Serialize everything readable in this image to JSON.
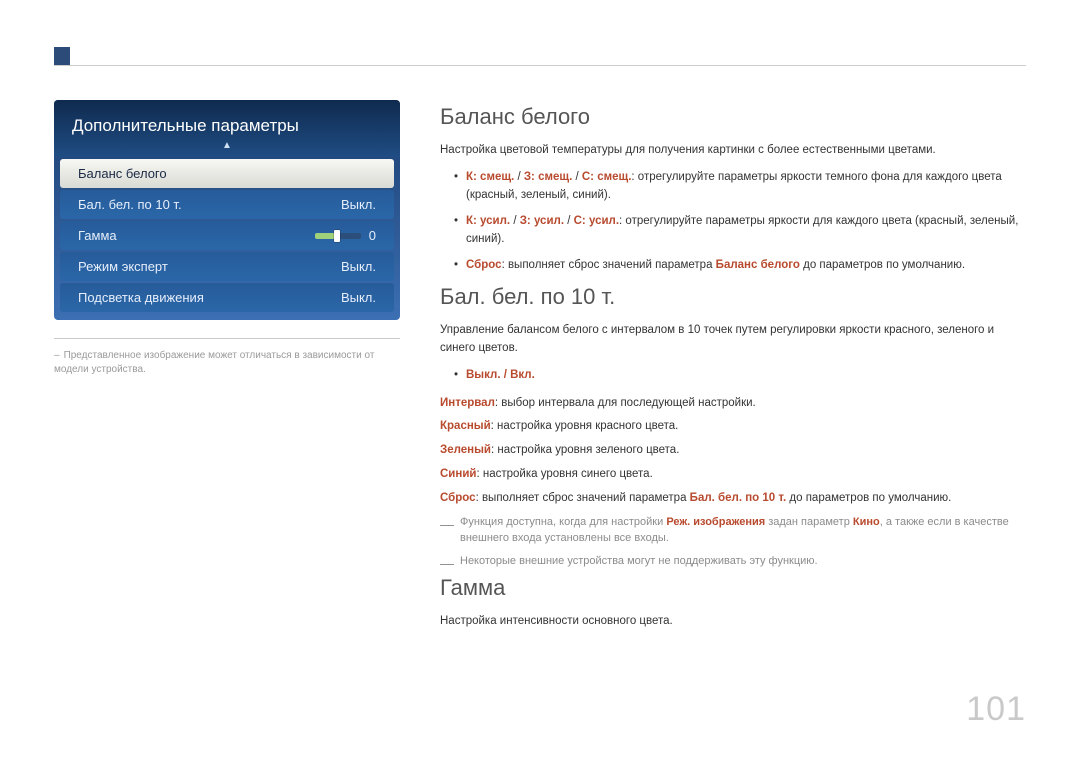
{
  "page_number": "101",
  "panel": {
    "title": "Дополнительные параметры",
    "rows": [
      {
        "label": "Баланс белого",
        "value": "",
        "active": true
      },
      {
        "label": "Бал. бел. по 10 т.",
        "value": "Выкл."
      },
      {
        "label": "Гамма",
        "value": "0",
        "slider": true
      },
      {
        "label": "Режим эксперт",
        "value": "Выкл."
      },
      {
        "label": "Подсветка движения",
        "value": "Выкл."
      }
    ]
  },
  "left_caption": "Представленное изображение может отличаться в зависимости от модели устройства.",
  "section1": {
    "title": "Баланс белого",
    "desc": "Настройка цветовой температуры для получения картинки с более естественными цветами.",
    "b1_a": "К: смещ.",
    "b1_slash": " / ",
    "b1_b": "З: смещ.",
    "b1_c": "С: смещ.",
    "b1_rest": ": отрегулируйте параметры яркости темного фона для каждого цвета (красный, зеленый, синий).",
    "b2_a": "К: усил.",
    "b2_b": "З: усил.",
    "b2_c": "С: усил.",
    "b2_rest": ": отрегулируйте параметры яркости для каждого цвета (красный, зеленый, синий).",
    "b3_a": "Сброс",
    "b3_mid": ": выполняет сброс значений параметра ",
    "b3_t": "Баланс белого",
    "b3_end": " до параметров по умолчанию."
  },
  "section2": {
    "title": "Бал. бел. по 10 т.",
    "desc": "Управление балансом белого с интервалом в 10 точек путем регулировки яркости красного, зеленого и синего цветов.",
    "bullet1": "Выкл. / Вкл.",
    "line_interval_a": "Интервал",
    "line_interval_b": ": выбор интервала для последующей настройки.",
    "line_red_a": "Красный",
    "line_red_b": ": настройка уровня красного цвета.",
    "line_green_a": "Зеленый",
    "line_green_b": ": настройка уровня зеленого цвета.",
    "line_blue_a": "Синий",
    "line_blue_b": ": настройка уровня синего цвета.",
    "line_reset_a": "Сброс",
    "line_reset_mid": ": выполняет сброс значений параметра ",
    "line_reset_t": "Бал. бел. по 10 т.",
    "line_reset_end": " до параметров по умолчанию.",
    "note1_a": "Функция доступна, когда для настройки ",
    "note1_t1": "Реж. изображения",
    "note1_mid": " задан параметр ",
    "note1_t2": "Кино",
    "note1_end": ", а также если в качестве внешнего входа установлены все входы.",
    "note2": "Некоторые внешние устройства могут не поддерживать эту функцию."
  },
  "section3": {
    "title": "Гамма",
    "desc": "Настройка интенсивности основного цвета."
  }
}
